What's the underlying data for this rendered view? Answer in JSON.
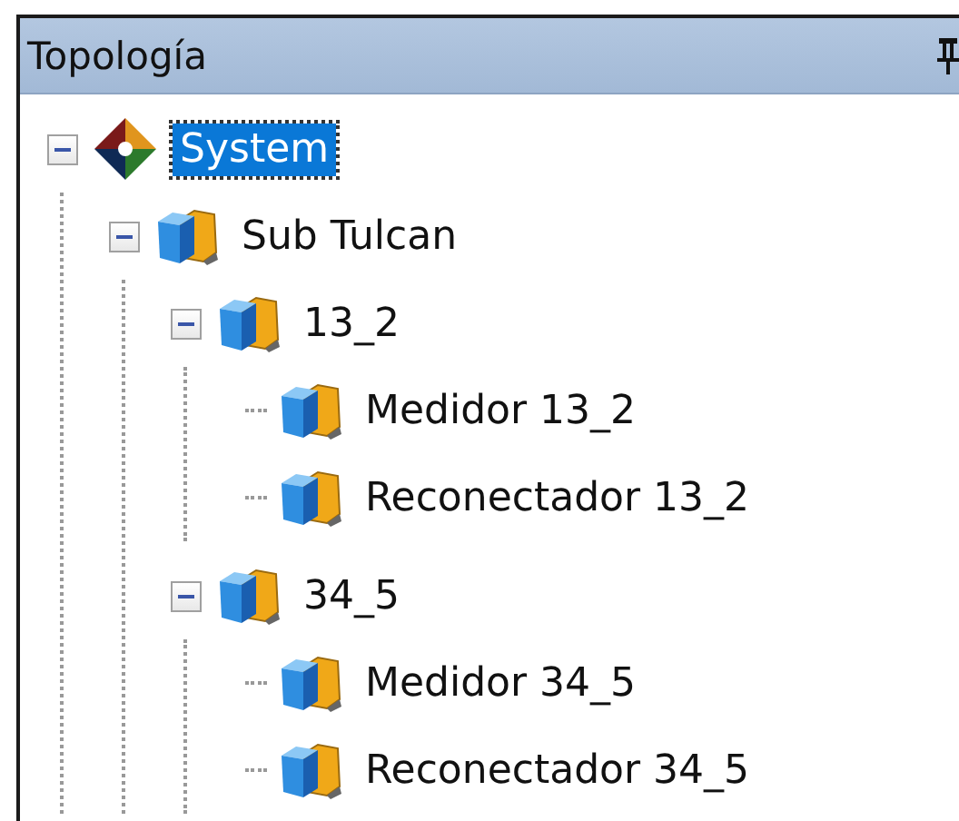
{
  "panel": {
    "title": "Topología",
    "pinned": true
  },
  "tree": [
    {
      "label": "System",
      "kind": "system",
      "selected": true,
      "expanded": true,
      "children": [
        {
          "label": "Sub Tulcan",
          "kind": "device",
          "selected": false,
          "expanded": true,
          "children": [
            {
              "label": "13_2",
              "kind": "device",
              "selected": false,
              "expanded": true,
              "children": [
                {
                  "label": "Medidor 13_2",
                  "kind": "device",
                  "selected": false
                },
                {
                  "label": "Reconectador 13_2",
                  "kind": "device",
                  "selected": false
                }
              ]
            },
            {
              "label": "34_5",
              "kind": "device",
              "selected": false,
              "expanded": true,
              "children": [
                {
                  "label": "Medidor 34_5",
                  "kind": "device",
                  "selected": false
                },
                {
                  "label": "Reconectador 34_5",
                  "kind": "device",
                  "selected": false
                }
              ]
            }
          ]
        }
      ]
    }
  ]
}
